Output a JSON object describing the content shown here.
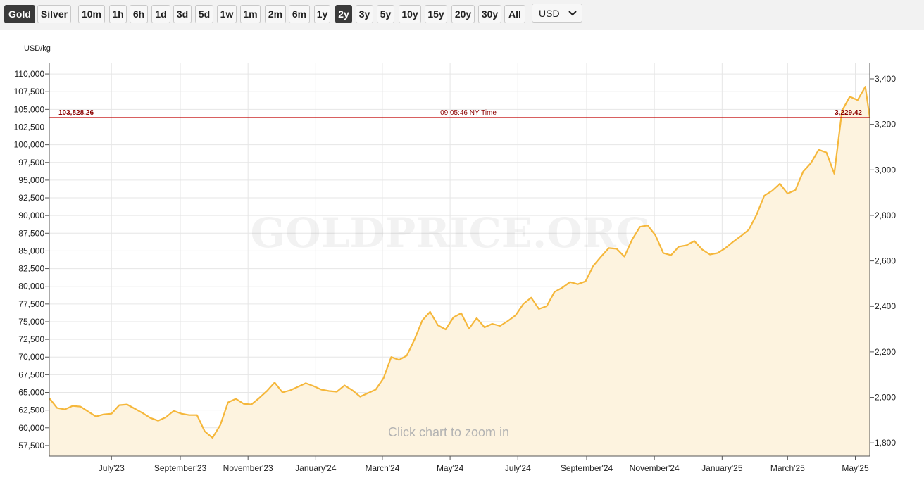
{
  "toolbar": {
    "metals": [
      {
        "label": "Gold",
        "active": true
      },
      {
        "label": "Silver",
        "active": false
      }
    ],
    "ranges": [
      {
        "label": "10m",
        "active": false
      },
      {
        "label": "1h",
        "active": false
      },
      {
        "label": "6h",
        "active": false
      },
      {
        "label": "1d",
        "active": false
      },
      {
        "label": "3d",
        "active": false
      },
      {
        "label": "5d",
        "active": false
      },
      {
        "label": "1w",
        "active": false
      },
      {
        "label": "1m",
        "active": false
      },
      {
        "label": "2m",
        "active": false
      },
      {
        "label": "6m",
        "active": false
      },
      {
        "label": "1y",
        "active": false
      },
      {
        "label": "2y",
        "active": true
      },
      {
        "label": "3y",
        "active": false
      },
      {
        "label": "5y",
        "active": false
      },
      {
        "label": "10y",
        "active": false
      },
      {
        "label": "15y",
        "active": false
      },
      {
        "label": "20y",
        "active": false
      },
      {
        "label": "30y",
        "active": false
      },
      {
        "label": "All",
        "active": false
      }
    ],
    "currency": "USD"
  },
  "colors": {
    "line": "#f5b73b",
    "fill": "#fdf3df",
    "current_line": "#c00000",
    "current_text": "#8b0000",
    "active_button": "#3a3a3a"
  },
  "chart_data": {
    "type": "area",
    "ylabel": "USD/kg",
    "ylim": [
      56000,
      111500
    ],
    "y_ticks": [
      "57,500",
      "60,000",
      "62,500",
      "65,000",
      "67,500",
      "70,000",
      "72,500",
      "75,000",
      "77,500",
      "80,000",
      "82,500",
      "85,000",
      "87,500",
      "90,000",
      "92,500",
      "95,000",
      "97,500",
      "100,000",
      "102,500",
      "105,000",
      "107,500",
      "110,000"
    ],
    "y_tick_values": [
      57500,
      60000,
      62500,
      65000,
      67500,
      70000,
      72500,
      75000,
      77500,
      80000,
      82500,
      85000,
      87500,
      90000,
      92500,
      95000,
      97500,
      100000,
      102500,
      105000,
      107500,
      110000
    ],
    "right_axis_ticks": [
      "1,800",
      "2,000",
      "2,200",
      "2,400",
      "2,600",
      "2,800",
      "3,000",
      "3,200",
      "3,400"
    ],
    "right_axis_values": [
      1800,
      2000,
      2200,
      2400,
      2600,
      2800,
      3000,
      3200,
      3400
    ],
    "x_range": [
      "2023-05-06",
      "2025-05-14"
    ],
    "x_ticks": [
      "July'23",
      "September'23",
      "November'23",
      "January'24",
      "March'24",
      "May'24",
      "July'24",
      "September'24",
      "November'24",
      "January'25",
      "March'25",
      "May'25"
    ],
    "x_tick_dates": [
      "2023-07-01",
      "2023-09-01",
      "2023-11-01",
      "2024-01-01",
      "2024-03-01",
      "2024-05-01",
      "2024-07-01",
      "2024-09-01",
      "2024-11-01",
      "2025-01-01",
      "2025-03-01",
      "2025-05-01"
    ],
    "grid": true,
    "watermark": "GOLDPRICE.ORG",
    "zoom_hint": "Click chart to zoom in",
    "current": {
      "value": 103828.26,
      "left_label": "103,828.26",
      "right_label": "3,229.42",
      "time": "09:05:46 NY Time"
    },
    "series": [
      {
        "x": [
          "2023-05-06",
          "2023-05-13",
          "2023-05-20",
          "2023-05-27",
          "2023-06-03",
          "2023-06-10",
          "2023-06-17",
          "2023-06-24",
          "2023-07-01",
          "2023-07-08",
          "2023-07-15",
          "2023-07-22",
          "2023-07-29",
          "2023-08-05",
          "2023-08-12",
          "2023-08-19",
          "2023-08-26",
          "2023-09-02",
          "2023-09-09",
          "2023-09-16",
          "2023-09-23",
          "2023-09-30",
          "2023-10-07",
          "2023-10-14",
          "2023-10-21",
          "2023-10-28",
          "2023-11-04",
          "2023-11-11",
          "2023-11-18",
          "2023-11-25",
          "2023-12-02",
          "2023-12-09",
          "2023-12-16",
          "2023-12-23",
          "2023-12-30",
          "2024-01-06",
          "2024-01-13",
          "2024-01-20",
          "2024-01-27",
          "2024-02-03",
          "2024-02-10",
          "2024-02-17",
          "2024-02-24",
          "2024-03-02",
          "2024-03-09",
          "2024-03-16",
          "2024-03-23",
          "2024-03-30",
          "2024-04-06",
          "2024-04-13",
          "2024-04-20",
          "2024-04-27",
          "2024-05-04",
          "2024-05-11",
          "2024-05-18",
          "2024-05-25",
          "2024-06-01",
          "2024-06-08",
          "2024-06-15",
          "2024-06-22",
          "2024-06-29",
          "2024-07-06",
          "2024-07-13",
          "2024-07-20",
          "2024-07-27",
          "2024-08-03",
          "2024-08-10",
          "2024-08-17",
          "2024-08-24",
          "2024-08-31",
          "2024-09-07",
          "2024-09-14",
          "2024-09-21",
          "2024-09-28",
          "2024-10-05",
          "2024-10-12",
          "2024-10-19",
          "2024-10-26",
          "2024-11-02",
          "2024-11-09",
          "2024-11-16",
          "2024-11-23",
          "2024-11-30",
          "2024-12-07",
          "2024-12-14",
          "2024-12-21",
          "2024-12-28",
          "2025-01-04",
          "2025-01-11",
          "2025-01-18",
          "2025-01-25",
          "2025-02-01",
          "2025-02-08",
          "2025-02-15",
          "2025-02-22",
          "2025-03-01",
          "2025-03-08",
          "2025-03-15",
          "2025-03-22",
          "2025-03-29",
          "2025-04-05",
          "2025-04-12",
          "2025-04-19",
          "2025-04-26",
          "2025-05-03",
          "2025-05-10",
          "2025-05-14"
        ],
        "values": [
          64200,
          62800,
          62600,
          63100,
          63000,
          62300,
          61600,
          61900,
          62000,
          63200,
          63300,
          62700,
          62100,
          61400,
          61000,
          61500,
          62400,
          62000,
          61800,
          61800,
          59500,
          58600,
          60400,
          63600,
          64100,
          63400,
          63300,
          64200,
          65200,
          66400,
          65000,
          65300,
          65800,
          66300,
          65900,
          65400,
          65200,
          65100,
          66000,
          65300,
          64400,
          64900,
          65400,
          67000,
          70000,
          69600,
          70200,
          72500,
          75200,
          76400,
          74500,
          73900,
          75600,
          76200,
          74000,
          75500,
          74200,
          74700,
          74400,
          75100,
          75900,
          77500,
          78400,
          76800,
          77200,
          79200,
          79800,
          80600,
          80300,
          80700,
          82900,
          84200,
          85400,
          85300,
          84200,
          86600,
          88400,
          88600,
          87200,
          84700,
          84400,
          85600,
          85800,
          86400,
          85200,
          84500,
          84700,
          85400,
          86300,
          87100,
          88000,
          90100,
          92800,
          93500,
          94500,
          93100,
          93600,
          96200,
          97400,
          99300,
          98900,
          95900,
          104800,
          106800,
          106300,
          108200,
          103828.26
        ]
      }
    ]
  }
}
